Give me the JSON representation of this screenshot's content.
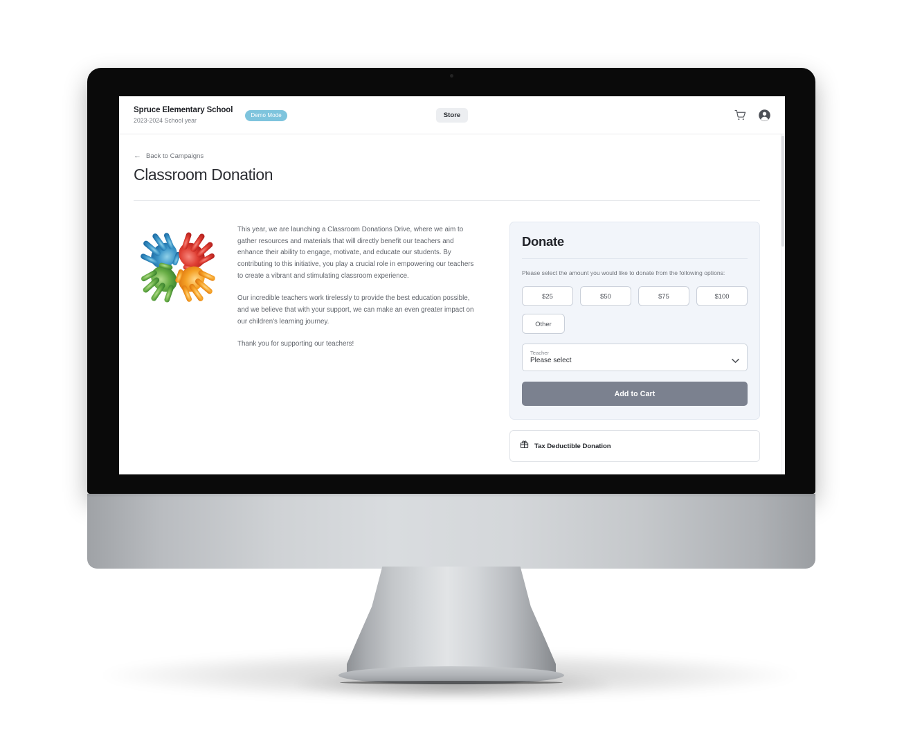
{
  "header": {
    "brand_name": "Spruce Elementary School",
    "brand_subtitle": "2023-2024 School year",
    "demo_badge": "Demo Mode",
    "store_label": "Store",
    "cart_icon": "shopping-cart-icon",
    "account_icon": "user-account-icon"
  },
  "breadcrumb": {
    "back_arrow": "←",
    "back_label": "Back to Campaigns"
  },
  "page": {
    "title": "Classroom Donation"
  },
  "campaign": {
    "logo_alt": "four colorful handprints logo",
    "paragraphs": [
      "This year, we are launching a Classroom Donations Drive, where we aim to gather resources and materials that will directly benefit our teachers and enhance their ability to engage, motivate, and educate our students. By contributing to this initiative, you play a crucial role in empowering our teachers to create a vibrant and stimulating classroom experience.",
      "Our incredible teachers work tirelessly to provide the best education possible, and we believe that with your support, we can make an even greater impact on our children's learning journey.",
      "Thank you for supporting our teachers!"
    ]
  },
  "donate": {
    "title": "Donate",
    "prompt": "Please select the amount you would like to donate from the following options:",
    "amounts": [
      "$25",
      "$50",
      "$75",
      "$100"
    ],
    "other_label": "Other",
    "teacher_field": {
      "label": "Teacher",
      "value": "Please select",
      "caret_icon": "chevron-down-icon"
    },
    "add_to_cart_label": "Add to Cart"
  },
  "tax_card": {
    "icon": "gift-icon",
    "label": "Tax Deductible Donation"
  },
  "colors": {
    "demo_badge_bg": "#7ec4dd",
    "panel_bg": "#f2f5fa",
    "cart_button_bg": "#7b818f",
    "hand_blue": "#2e7fb8",
    "hand_red": "#d8352c",
    "hand_green": "#5aa83c",
    "hand_orange": "#f0951f"
  }
}
